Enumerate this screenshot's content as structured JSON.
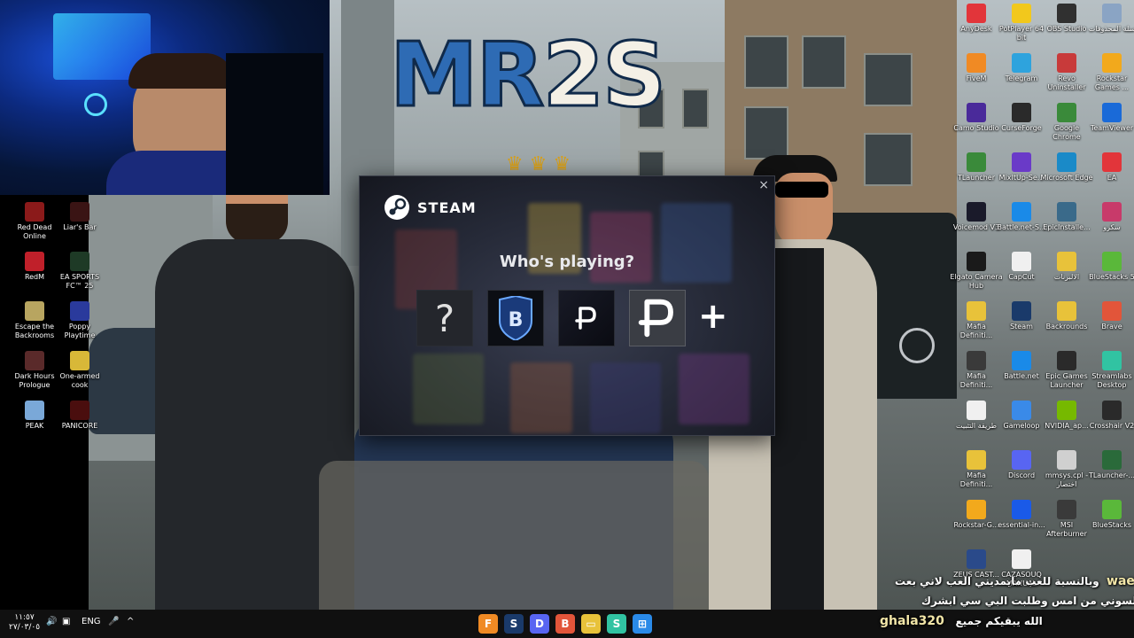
{
  "wallpaper": {
    "logo_left": "MR",
    "logo_right": "2S"
  },
  "steam": {
    "brand": "STEAM",
    "close_label": "×",
    "title": "Who's playing?",
    "profiles": [
      {
        "kind": "unknown",
        "glyph": "?"
      },
      {
        "kind": "team-logo",
        "glyph": "B"
      },
      {
        "kind": "p-logo-dark",
        "glyph": "P"
      },
      {
        "kind": "p-logo-light",
        "glyph": "P"
      }
    ],
    "add_label": "+"
  },
  "desktop_left": [
    {
      "label": "Red Dead Online",
      "icon": "red-dead-icon",
      "color": "#8b1a1a"
    },
    {
      "label": "Liar's Bar",
      "icon": "liars-bar-icon",
      "color": "#3a1414"
    },
    {
      "label": "RedM",
      "icon": "redm-icon",
      "color": "#c0202a"
    },
    {
      "label": "EA SPORTS FC™ 25",
      "icon": "fc25-icon",
      "color": "#1e3a26"
    },
    {
      "label": "Escape the Backrooms",
      "icon": "backrooms-icon",
      "color": "#b8a560"
    },
    {
      "label": "Poppy Playtime",
      "icon": "poppy-icon",
      "color": "#2a3a9c"
    },
    {
      "label": "Dark Hours Prologue",
      "icon": "dark-hours-icon",
      "color": "#5a2a2a"
    },
    {
      "label": "One-armed cook",
      "icon": "one-armed-cook-icon",
      "color": "#d8b838"
    },
    {
      "label": "PEAK",
      "icon": "peak-icon",
      "color": "#7aa8d8"
    },
    {
      "label": "PANICORE",
      "icon": "panicore-icon",
      "color": "#4a0e0e"
    }
  ],
  "desktop_right": [
    {
      "label": "AnyDesk",
      "icon": "anydesk-icon",
      "color": "#e2353a"
    },
    {
      "label": "PotPlayer 64 bit",
      "icon": "potplayer-icon",
      "color": "#f2c81c"
    },
    {
      "label": "OBS Studio",
      "icon": "obs-icon",
      "color": "#303030"
    },
    {
      "label": "سلة المحذوفات",
      "icon": "recycle-bin-icon",
      "color": "#8aa4c4"
    },
    {
      "label": "FiveM",
      "icon": "fivem-icon",
      "color": "#f08a24"
    },
    {
      "label": "Telegram",
      "icon": "telegram-icon",
      "color": "#2ea3dd"
    },
    {
      "label": "Revo Uninstaller",
      "icon": "revo-icon",
      "color": "#c83a3a"
    },
    {
      "label": "Rockstar Games ...",
      "icon": "rockstar-icon",
      "color": "#f2a91c"
    },
    {
      "label": "Camo Studio",
      "icon": "camo-icon",
      "color": "#4a2a9a"
    },
    {
      "label": "CurseForge",
      "icon": "curseforge-icon",
      "color": "#2a2a2a"
    },
    {
      "label": "Google Chrome",
      "icon": "chrome-icon",
      "color": "#3a8a3a"
    },
    {
      "label": "TeamViewer",
      "icon": "teamviewer-icon",
      "color": "#1a6ad8"
    },
    {
      "label": "TLauncher",
      "icon": "tlauncher-icon",
      "color": "#3a8a3a"
    },
    {
      "label": "MixItUp-Se...",
      "icon": "mixitup-icon",
      "color": "#6a3ac8"
    },
    {
      "label": "Microsoft Edge",
      "icon": "edge-icon",
      "color": "#1a8ac8"
    },
    {
      "label": "EA",
      "icon": "ea-icon",
      "color": "#e2353a"
    },
    {
      "label": "Voicemod V3",
      "icon": "voicemod-icon",
      "color": "#1a1a2a"
    },
    {
      "label": "Battle.net-S...",
      "icon": "battlenet-icon",
      "color": "#1a8ae8"
    },
    {
      "label": "EpicInstalle...",
      "icon": "epic-installer-icon",
      "color": "#3a6a8a"
    },
    {
      "label": "سكرو",
      "icon": "skro-icon",
      "color": "#c83a6a"
    },
    {
      "label": "Elgato Camera Hub",
      "icon": "elgato-icon",
      "color": "#1a1a1a"
    },
    {
      "label": "CapCut",
      "icon": "capcut-icon",
      "color": "#f0f0f0"
    },
    {
      "label": "الالبرنات",
      "icon": "folder-icon",
      "color": "#e8c23a"
    },
    {
      "label": "BlueStacks 5",
      "icon": "bluestacks-icon",
      "color": "#5ab83a"
    },
    {
      "label": "Mafia Definiti...",
      "icon": "folder-icon",
      "color": "#e8c23a"
    },
    {
      "label": "Steam",
      "icon": "steam-icon",
      "color": "#1a3a6a"
    },
    {
      "label": "Backrounds",
      "icon": "folder-icon",
      "color": "#e8c23a"
    },
    {
      "label": "Brave",
      "icon": "brave-icon",
      "color": "#e2553a"
    },
    {
      "label": "Mafia Definiti...",
      "icon": "mafia-icon",
      "color": "#3a3a3a"
    },
    {
      "label": "Battle.net",
      "icon": "battlenet-icon",
      "color": "#1a8ae8"
    },
    {
      "label": "Epic Games Launcher",
      "icon": "epic-icon",
      "color": "#2a2a2a"
    },
    {
      "label": "Streamlabs Desktop",
      "icon": "streamlabs-icon",
      "color": "#31c3a2"
    },
    {
      "label": "طريقة التثبيت",
      "icon": "text-file-icon",
      "color": "#f0f0f0"
    },
    {
      "label": "Gameloop",
      "icon": "gameloop-icon",
      "color": "#3a8ae8"
    },
    {
      "label": "NVIDIA_ap...",
      "icon": "nvidia-icon",
      "color": "#76b900"
    },
    {
      "label": "Crosshair V2",
      "icon": "crosshair-icon",
      "color": "#2a2a2a"
    },
    {
      "label": "Mafia Definiti...",
      "icon": "folder-icon",
      "color": "#e8c23a"
    },
    {
      "label": "Discord",
      "icon": "discord-icon",
      "color": "#5865f2"
    },
    {
      "label": "mmsys.cpl - اختصار",
      "icon": "shortcut-icon",
      "color": "#d0d0d0"
    },
    {
      "label": "TLauncher-...",
      "icon": "tlauncher-icon",
      "color": "#2a6a3a"
    },
    {
      "label": "Rockstar-G...",
      "icon": "rockstar-icon",
      "color": "#f2a91c"
    },
    {
      "label": "essential-in...",
      "icon": "essential-icon",
      "color": "#1a5ae8"
    },
    {
      "label": "MSI Afterburner",
      "icon": "msi-icon",
      "color": "#3a3a3a"
    },
    {
      "label": "BlueStacks",
      "icon": "bluestacks-icon",
      "color": "#5ab83a"
    },
    {
      "label": "ZEUS CAST...",
      "icon": "zeus-icon",
      "color": "#2a4a8a"
    },
    {
      "label": "CAZASOUQ MANUAL",
      "icon": "pdf-icon",
      "color": "#f0f0f0"
    }
  ],
  "chat": [
    {
      "user": "wael_8",
      "text": "وبالنسبة للعب مايمديني العب لاني بعت"
    },
    {
      "user": "",
      "text": "السوني من امس وطلبت البي سي ابشرك"
    },
    {
      "user": "ghala320",
      "text": "الله يبقيكم جميع"
    }
  ],
  "taskbar": {
    "time": "١١:٥٧",
    "date": "٢٧/٠٣/٠٥",
    "lang": "ENG",
    "tray_up": "^",
    "apps": [
      {
        "name": "fivem-taskbar-icon",
        "glyph": "F",
        "color": "#f08a24"
      },
      {
        "name": "steam-taskbar-icon",
        "glyph": "S",
        "color": "#1a3a6a"
      },
      {
        "name": "discord-taskbar-icon",
        "glyph": "D",
        "color": "#5865f2"
      },
      {
        "name": "brave-taskbar-icon",
        "glyph": "B",
        "color": "#e2553a"
      },
      {
        "name": "explorer-taskbar-icon",
        "glyph": "▭",
        "color": "#e8c23a"
      },
      {
        "name": "streamlabs-taskbar-icon",
        "glyph": "S",
        "color": "#31c3a2"
      },
      {
        "name": "start-button-icon",
        "glyph": "⊞",
        "color": "#2a8ae8"
      }
    ]
  }
}
